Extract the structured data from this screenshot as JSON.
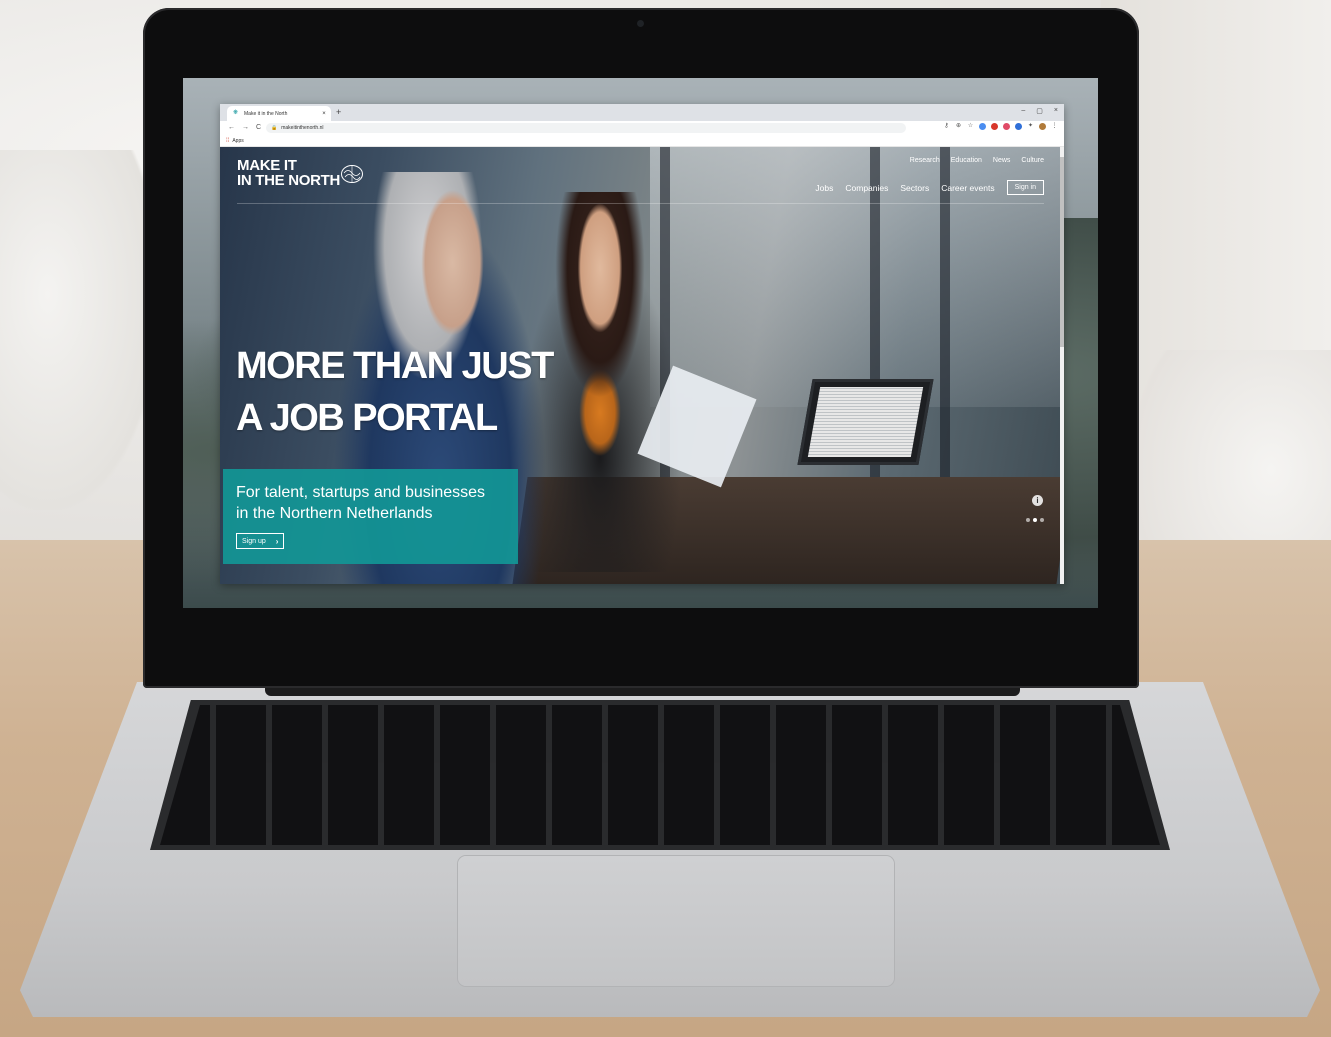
{
  "browser": {
    "tab_title": "Make it in the North",
    "tab_close": "×",
    "new_tab": "+",
    "window_controls": [
      "–",
      "▢",
      "×"
    ],
    "nav": [
      "←",
      "→",
      "C"
    ],
    "url": "makeitinthenorth.nl",
    "bookmarks_label": "Apps"
  },
  "site": {
    "logo_line1": "MAKE IT",
    "logo_line2": "IN THE NORTH",
    "top_nav": [
      "Research",
      "Education",
      "News",
      "Culture"
    ],
    "main_nav": [
      "Jobs",
      "Companies",
      "Sectors",
      "Career events"
    ],
    "signin_label": "Sign in",
    "hero_title_line1": "MORE THAN JUST",
    "hero_title_line2": "A JOB PORTAL",
    "hero_sub_line1": "For talent, startups and businesses",
    "hero_sub_line2": "in the Northern Netherlands",
    "signup_label": "Sign up",
    "signup_chevron": "›",
    "info_glyph": "i",
    "carousel": {
      "count": 3,
      "active": 2
    }
  },
  "colors": {
    "accent_teal": "#129696",
    "tab_strip": "#dee1e6"
  }
}
